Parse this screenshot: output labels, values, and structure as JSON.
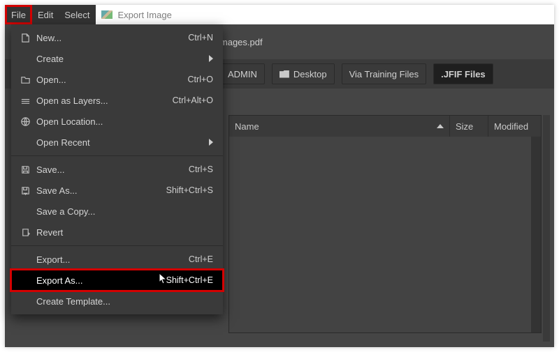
{
  "menubar": {
    "file": "File",
    "edit": "Edit",
    "select": "Select"
  },
  "title": "Export Image",
  "tab": {
    "name": "images.pdf"
  },
  "breadcrumbs": [
    {
      "label": "ADMIN",
      "icon": false,
      "active": false
    },
    {
      "label": "Desktop",
      "icon": true,
      "active": false
    },
    {
      "label": "Via Training Files",
      "icon": false,
      "active": false
    },
    {
      "label": ".JFIF Files",
      "icon": false,
      "active": true
    }
  ],
  "file_columns": {
    "name": "Name",
    "size": "Size",
    "modified": "Modified"
  },
  "file_menu": [
    {
      "type": "item",
      "icon": "new",
      "label": "New...",
      "accel": "Ctrl+N"
    },
    {
      "type": "item",
      "icon": "",
      "label": "Create",
      "submenu": true
    },
    {
      "type": "item",
      "icon": "open",
      "label": "Open...",
      "accel": "Ctrl+O"
    },
    {
      "type": "item",
      "icon": "layers",
      "label": "Open as Layers...",
      "accel": "Ctrl+Alt+O"
    },
    {
      "type": "item",
      "icon": "globe",
      "label": "Open Location..."
    },
    {
      "type": "item",
      "icon": "",
      "label": "Open Recent",
      "submenu": true
    },
    {
      "type": "sep"
    },
    {
      "type": "item",
      "icon": "save",
      "label": "Save...",
      "accel": "Ctrl+S"
    },
    {
      "type": "item",
      "icon": "saveas",
      "label": "Save As...",
      "accel": "Shift+Ctrl+S"
    },
    {
      "type": "item",
      "icon": "",
      "label": "Save a Copy..."
    },
    {
      "type": "item",
      "icon": "revert",
      "label": "Revert"
    },
    {
      "type": "sep"
    },
    {
      "type": "item",
      "icon": "",
      "label": "Export...",
      "accel": "Ctrl+E"
    },
    {
      "type": "item",
      "icon": "",
      "label": "Export As...",
      "accel": "Shift+Ctrl+E",
      "highlight": true,
      "cursor": true
    },
    {
      "type": "item",
      "icon": "",
      "label": "Create Template..."
    }
  ]
}
